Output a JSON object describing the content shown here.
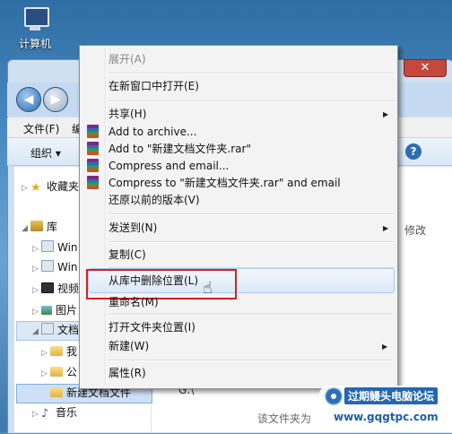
{
  "desktop": {
    "computer_label": "计算机"
  },
  "window": {
    "close_glyph": "✕",
    "menubar": {
      "file": "文件(F)",
      "edit": "编"
    },
    "toolbar": {
      "organize": "组织 ▾",
      "help": "?"
    },
    "content": {
      "column_header": "修改",
      "path": "G:\\",
      "empty_text": "该文件夹为"
    }
  },
  "navpane": {
    "favorites": "收藏夹",
    "library": "库",
    "items": [
      {
        "label": "Win"
      },
      {
        "label": "Win"
      },
      {
        "label": "视频"
      },
      {
        "label": "图片"
      },
      {
        "label": "文档"
      },
      {
        "label": "我"
      },
      {
        "label": "公"
      },
      {
        "label": "新建文档文件"
      },
      {
        "label": "音乐"
      }
    ]
  },
  "context_menu": {
    "expand": "展开(A)",
    "open_new_window": "在新窗口中打开(E)",
    "share": "共享(H)",
    "add_to_archive": "Add to archive...",
    "add_to_rar": "Add to \"新建文档文件夹.rar\"",
    "compress_email": "Compress and email...",
    "compress_rar_email": "Compress to \"新建文档文件夹.rar\" and email",
    "restore_previous": "还原以前的版本(V)",
    "send_to": "发送到(N)",
    "copy": "复制(C)",
    "remove_from_library": "从库中删除位置(L)",
    "rename": "重命名(M)",
    "open_folder_location": "打开文件夹位置(I)",
    "new": "新建(W)",
    "properties": "属性(R)",
    "submenu_arrow": "▶"
  },
  "watermark": {
    "title": "过期鳗头电脑论坛",
    "url": "www.gqgtpc.com"
  },
  "colors": {
    "highlight_border": "#d62020",
    "accent": "#2467b0"
  }
}
